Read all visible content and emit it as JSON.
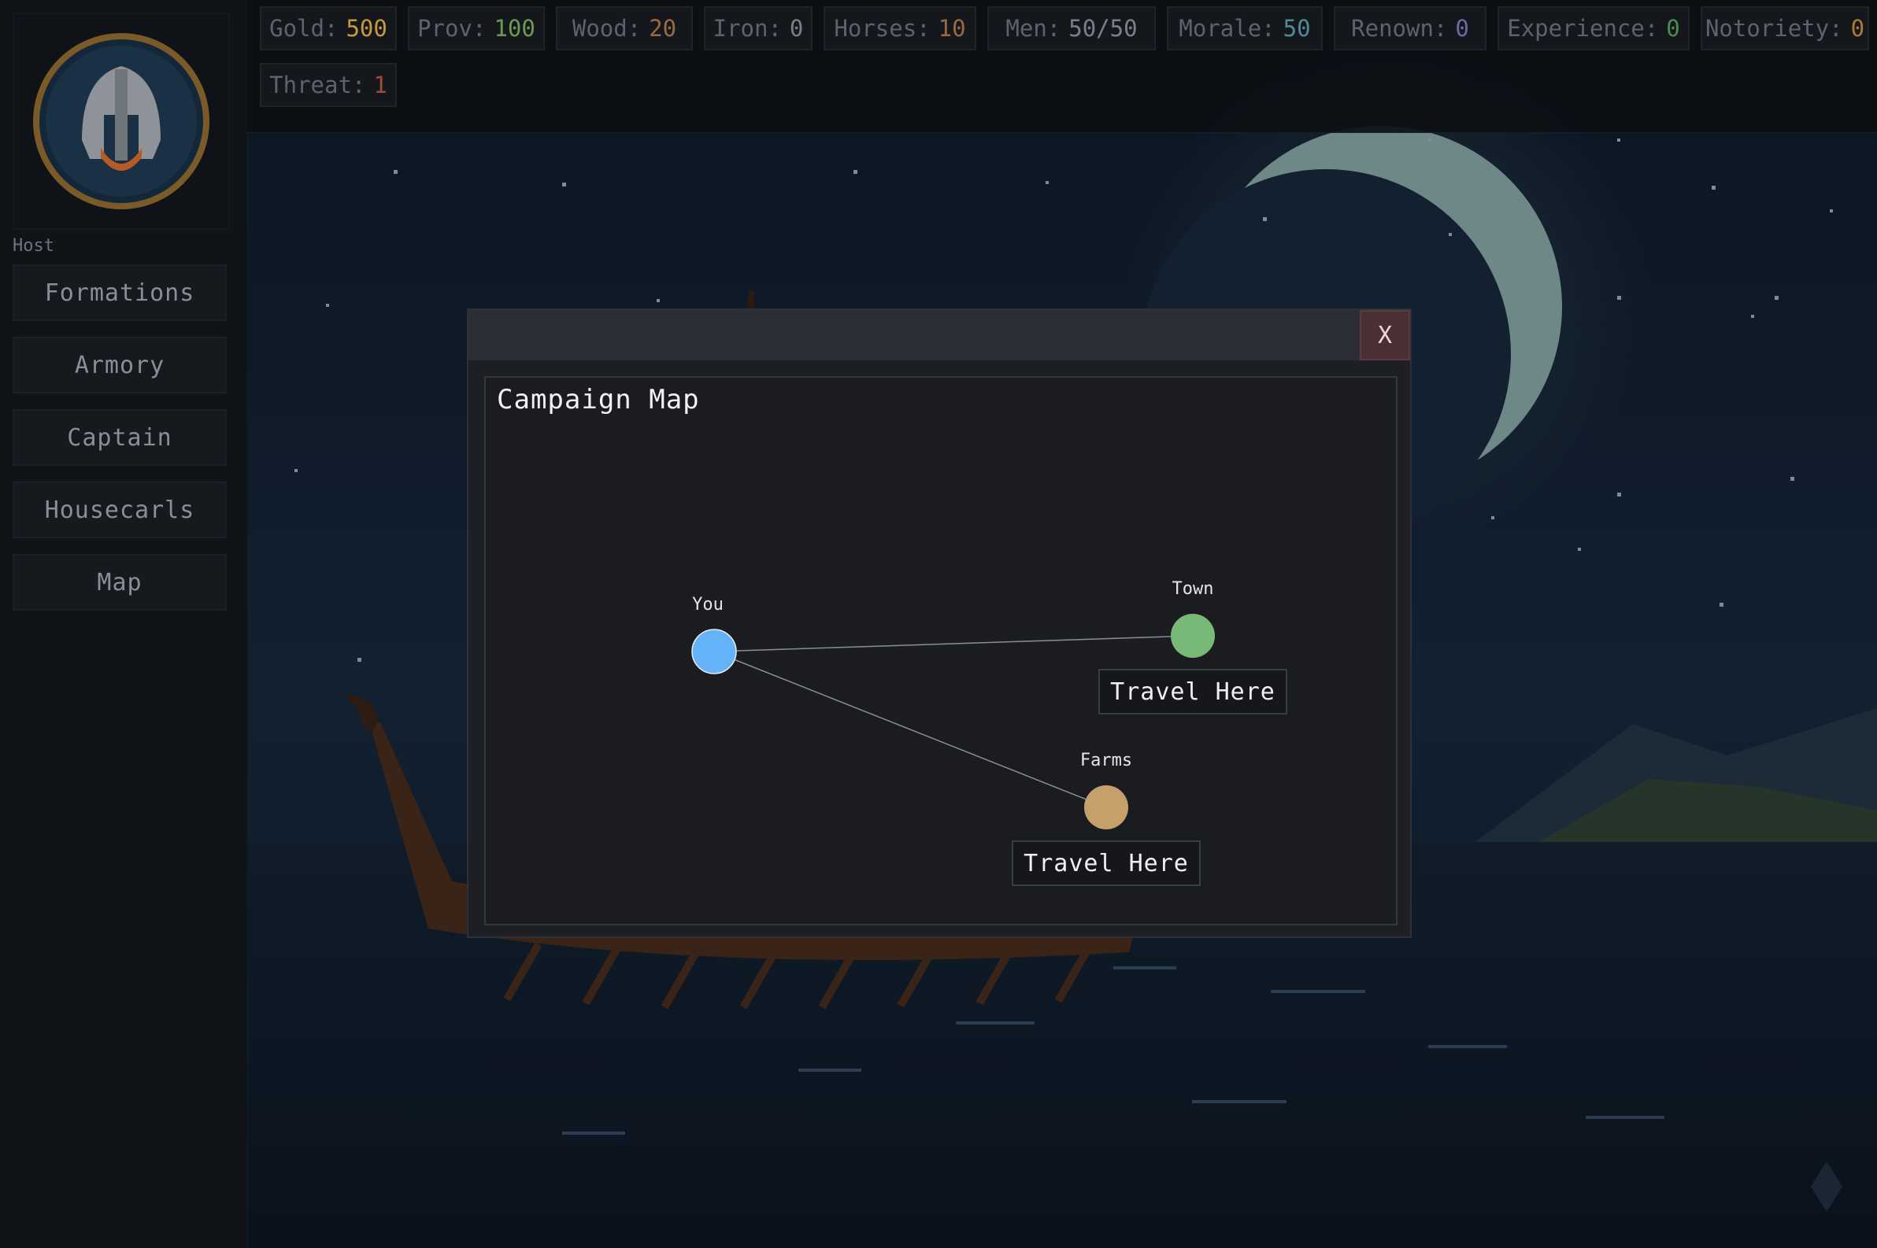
{
  "sidebar": {
    "host_label": "Host",
    "nav": [
      {
        "label": "Formations"
      },
      {
        "label": "Armory"
      },
      {
        "label": "Captain"
      },
      {
        "label": "Housecarls"
      },
      {
        "label": "Map"
      }
    ]
  },
  "resources": {
    "gold": {
      "label": "Gold:",
      "value": "500",
      "color": "#c79a3a"
    },
    "prov": {
      "label": "Prov:",
      "value": "100",
      "color": "#6f9a4e"
    },
    "wood": {
      "label": "Wood:",
      "value": "20",
      "color": "#9a6a3d"
    },
    "iron": {
      "label": "Iron:",
      "value": "0",
      "color": "#7b8087"
    },
    "horses": {
      "label": "Horses:",
      "value": "10",
      "color": "#9a6a3d"
    },
    "men": {
      "label": "Men:",
      "value": "50/50",
      "color": "#7b8087"
    },
    "morale": {
      "label": "Morale:",
      "value": "50",
      "color": "#4f8c95"
    },
    "renown": {
      "label": "Renown:",
      "value": "0",
      "color": "#6c6aa0"
    },
    "experience": {
      "label": "Experience:",
      "value": "0",
      "color": "#4e8a52"
    },
    "notoriety": {
      "label": "Notoriety:",
      "value": "0",
      "color": "#b07a35"
    },
    "threat": {
      "label": "Threat:",
      "value": "1",
      "color": "#a04a3a"
    }
  },
  "modal": {
    "close_label": "X",
    "title": "Campaign Map",
    "nodes": {
      "you": {
        "label": "You",
        "color": "#64b2f7"
      },
      "town": {
        "label": "Town",
        "color": "#78b978"
      },
      "farms": {
        "label": "Farms",
        "color": "#c5a06b"
      }
    },
    "travel_label": "Travel Here"
  }
}
